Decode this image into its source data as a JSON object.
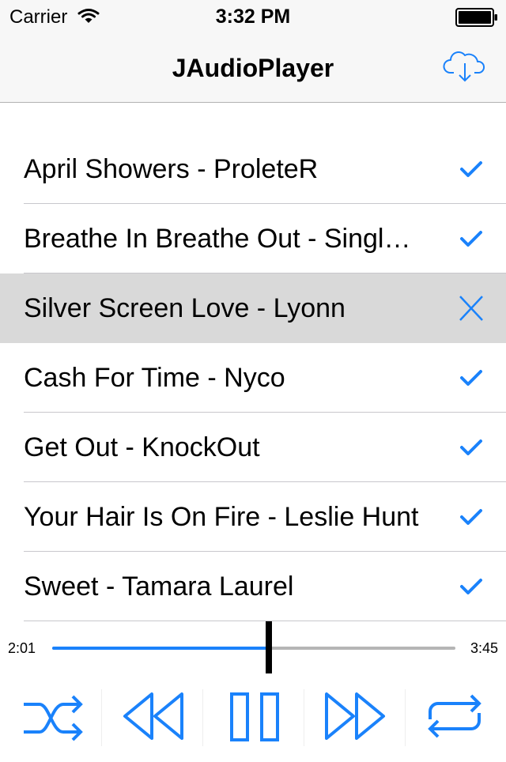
{
  "status_bar": {
    "carrier": "Carrier",
    "time": "3:32 PM"
  },
  "nav": {
    "title": "JAudioPlayer",
    "right_icon": "cloud-download-icon"
  },
  "tracks": [
    {
      "label": "April Showers - ProleteR",
      "status": "check"
    },
    {
      "label": "Breathe In Breathe Out - Singl…",
      "status": "check"
    },
    {
      "label": "Silver Screen Love - Lyonn",
      "status": "x",
      "selected": true
    },
    {
      "label": "Cash For Time - Nyco",
      "status": "check"
    },
    {
      "label": "Get Out - KnockOut",
      "status": "check"
    },
    {
      "label": "Your Hair Is On Fire - Leslie Hunt",
      "status": "check"
    },
    {
      "label": "Sweet - Tamara Laurel",
      "status": "check"
    }
  ],
  "player": {
    "elapsed": "2:01",
    "duration": "3:45",
    "progress": 0.538
  },
  "controls": [
    "shuffle-icon",
    "rewind-icon",
    "pause-icon",
    "fast-forward-icon",
    "repeat-icon"
  ],
  "colors": {
    "accent": "#1a82fb",
    "selected_row": "#d9d9d9",
    "bar_background": "#f7f7f7"
  }
}
